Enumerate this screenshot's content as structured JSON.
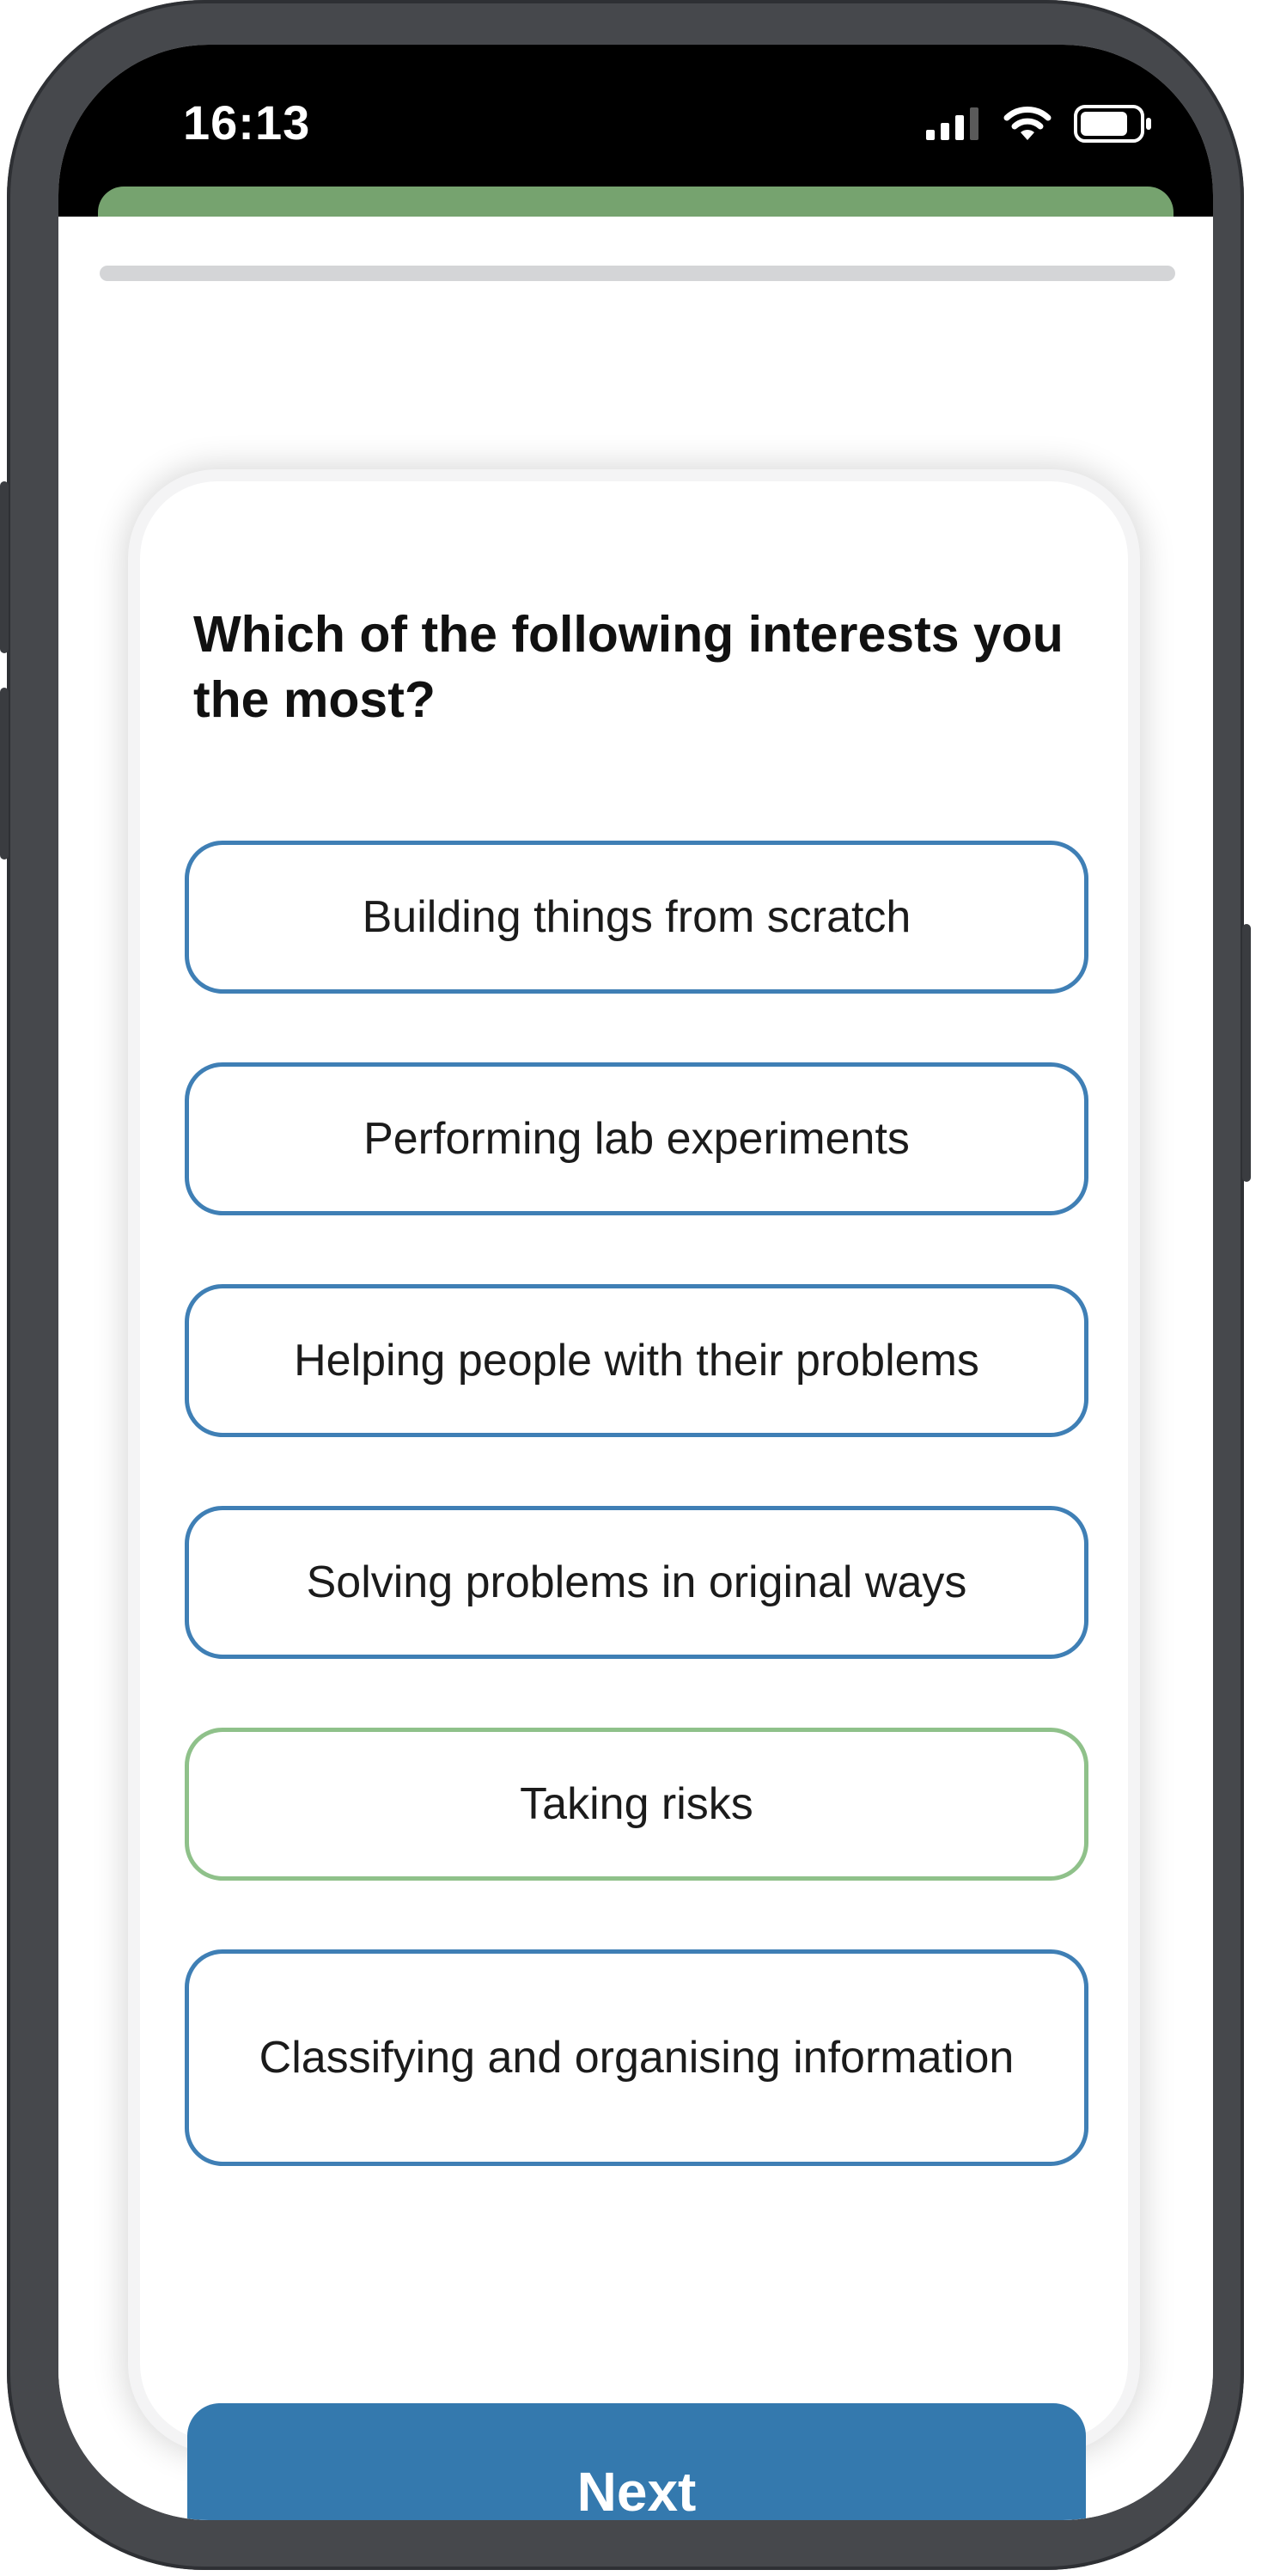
{
  "status_bar": {
    "time": "16:13",
    "icons": [
      "cellular-signal-icon",
      "wifi-icon",
      "battery-icon"
    ]
  },
  "quiz": {
    "question": "Which of the following interests you the most?",
    "options": [
      {
        "label": "Building things from scratch",
        "state": "default"
      },
      {
        "label": "Performing lab experiments",
        "state": "default"
      },
      {
        "label": "Helping people with their problems",
        "state": "default"
      },
      {
        "label": "Solving problems in original ways",
        "state": "default"
      },
      {
        "label": "Taking risks",
        "state": "highlighted"
      },
      {
        "label": "Classifying and organising information",
        "state": "default"
      }
    ],
    "next_label": "Next"
  },
  "colors": {
    "accent_blue": "#3479ae",
    "option_border": "#3f7fb5",
    "highlight_green": "#8fc18a",
    "header_green": "#76a36f",
    "frame": "#46484c"
  }
}
